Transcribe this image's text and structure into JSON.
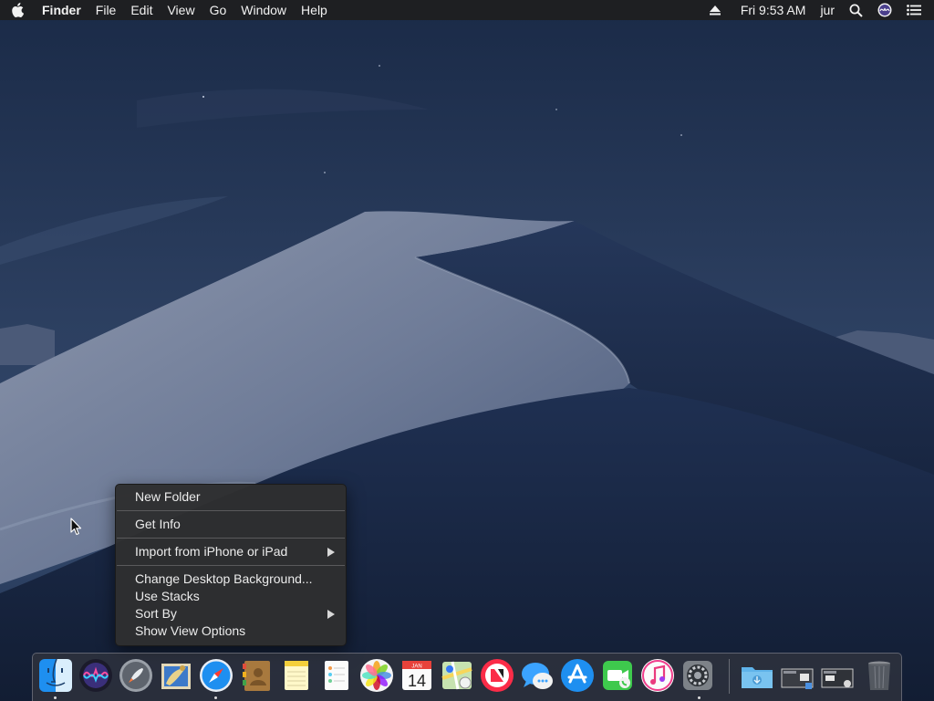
{
  "menubar": {
    "apple_icon": "apple-logo-icon",
    "app_name": "Finder",
    "menus": [
      "File",
      "Edit",
      "View",
      "Go",
      "Window",
      "Help"
    ],
    "status": {
      "eject_icon": "eject-icon",
      "clock": "Fri 9:53 AM",
      "user": "jur",
      "spotlight_icon": "search-icon",
      "siri_icon": "siri-icon",
      "notification_icon": "notification-center-icon"
    }
  },
  "context_menu": {
    "items": [
      {
        "label": "New Folder"
      },
      {
        "label": "Get Info"
      },
      {
        "label": "Import from iPhone or iPad",
        "submenu": true
      },
      {
        "label": "Change Desktop Background..."
      },
      {
        "label": "Use Stacks"
      },
      {
        "label": "Sort By",
        "submenu": true
      },
      {
        "label": "Show View Options"
      }
    ]
  },
  "dock": {
    "apps": [
      {
        "name": "Finder",
        "icon": "finder-icon",
        "running": true
      },
      {
        "name": "Siri",
        "icon": "siri-icon",
        "running": false
      },
      {
        "name": "Launchpad",
        "icon": "launchpad-icon",
        "running": false
      },
      {
        "name": "Mail",
        "icon": "mail-icon",
        "running": false
      },
      {
        "name": "Safari",
        "icon": "safari-icon",
        "running": true
      },
      {
        "name": "Contacts",
        "icon": "contacts-icon",
        "running": false
      },
      {
        "name": "Notes",
        "icon": "notes-icon",
        "running": false
      },
      {
        "name": "Reminders",
        "icon": "reminders-icon",
        "running": false
      },
      {
        "name": "Photos",
        "icon": "photos-icon",
        "running": false
      },
      {
        "name": "Calendar",
        "icon": "calendar-icon",
        "running": false,
        "month": "JAN",
        "day": "14"
      },
      {
        "name": "Maps",
        "icon": "maps-icon",
        "running": false
      },
      {
        "name": "News",
        "icon": "news-icon",
        "running": false
      },
      {
        "name": "Messages",
        "icon": "messages-icon",
        "running": false
      },
      {
        "name": "App Store",
        "icon": "app-store-icon",
        "running": false
      },
      {
        "name": "FaceTime",
        "icon": "facetime-icon",
        "running": false
      },
      {
        "name": "iTunes",
        "icon": "itunes-icon",
        "running": false
      },
      {
        "name": "System Preferences",
        "icon": "system-preferences-icon",
        "running": true
      }
    ],
    "stacks": [
      {
        "name": "Downloads",
        "icon": "downloads-folder-icon"
      },
      {
        "name": "Screenshot",
        "icon": "screenshot-stack-icon"
      },
      {
        "name": "Screenshot",
        "icon": "screenshot-stack-icon"
      },
      {
        "name": "Trash",
        "icon": "trash-icon"
      }
    ]
  }
}
